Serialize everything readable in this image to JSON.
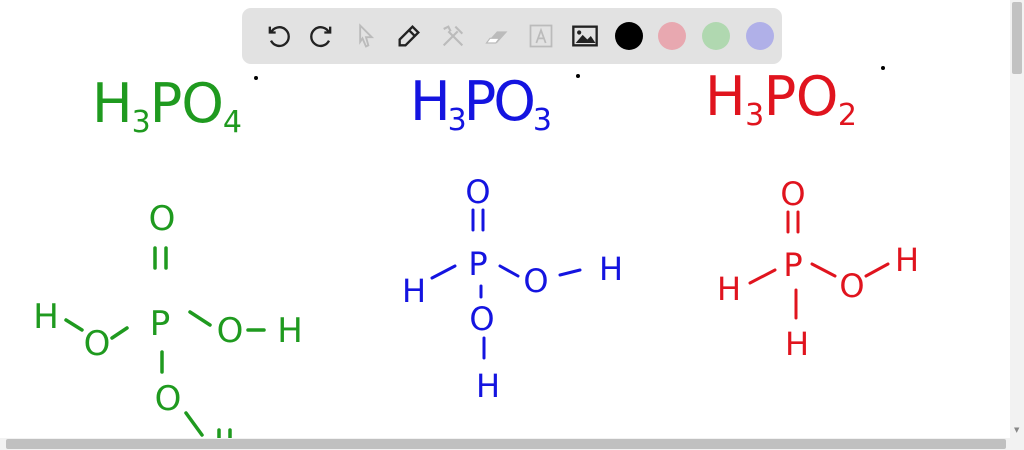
{
  "toolbar": {
    "tools": [
      "undo-icon",
      "redo-icon",
      "select-icon",
      "pen-icon",
      "tools-icon",
      "eraser-icon",
      "text-icon",
      "image-icon"
    ],
    "colors": [
      "#000000",
      "#e8a8b0",
      "#b0d8b0",
      "#b0b0e8"
    ]
  },
  "colors": {
    "green": "#1f9a1f",
    "blue": "#1414e0",
    "red": "#e0141e"
  },
  "formulas": [
    {
      "h": "H",
      "h_sub": "3",
      "p": "P",
      "o": "O",
      "o_sub": "4"
    },
    {
      "h": "H",
      "h_sub": "3",
      "p": "P",
      "o": "O",
      "o_sub": "3"
    },
    {
      "h": "H",
      "h_sub": "3",
      "p": "P",
      "o": "O",
      "o_sub": "2"
    }
  ],
  "atoms": {
    "H": "H",
    "O": "O",
    "P": "P"
  }
}
